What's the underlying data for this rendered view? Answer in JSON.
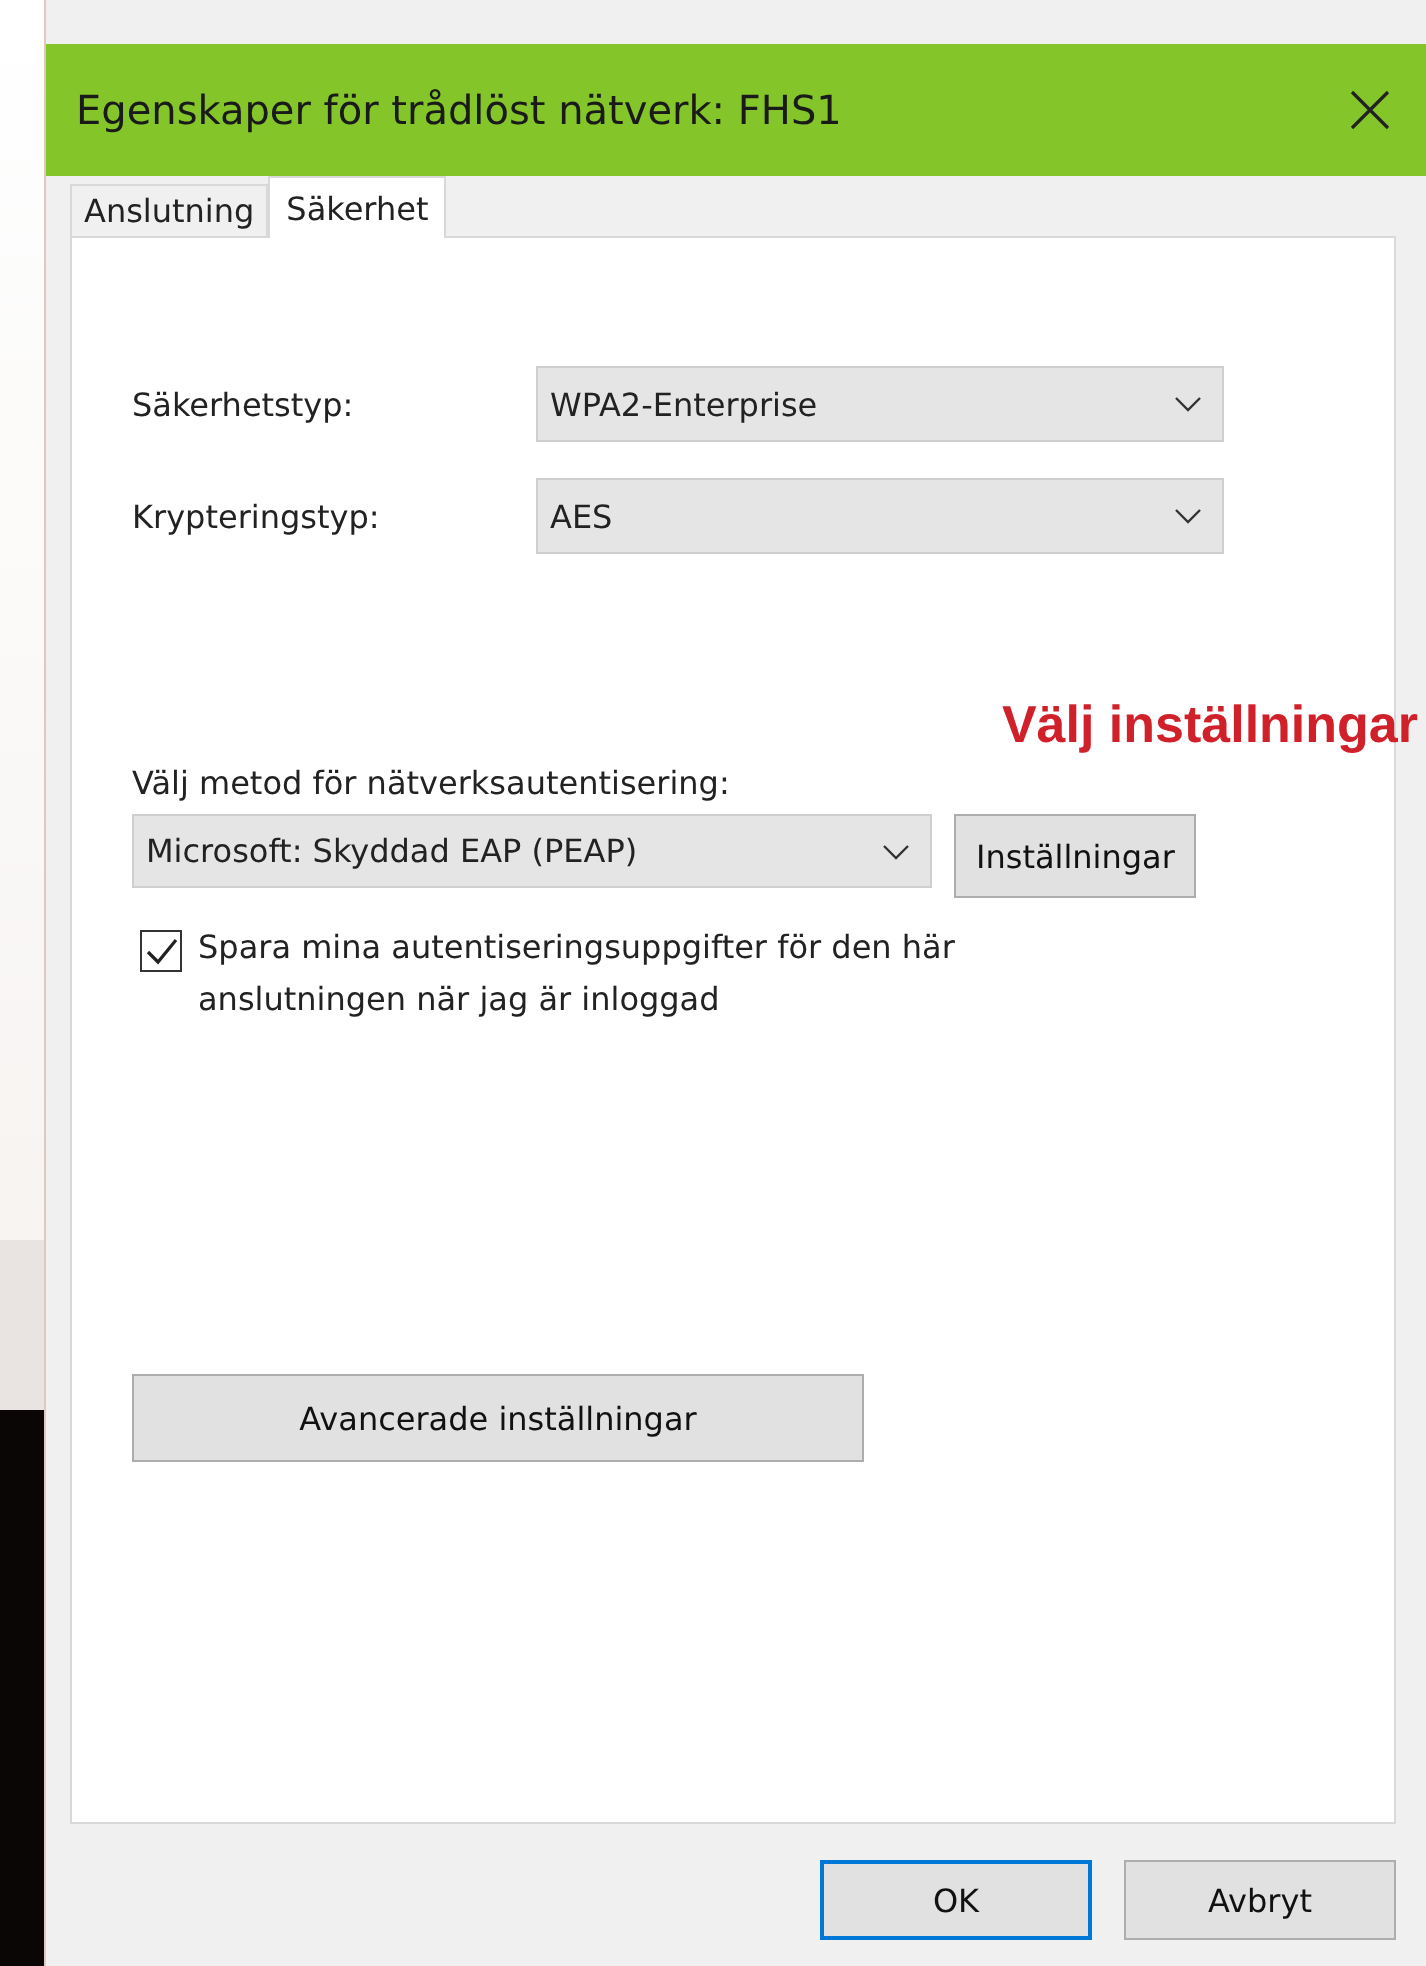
{
  "window": {
    "title": "Egenskaper för trådlöst nätverk: FHS1"
  },
  "tabs": [
    {
      "label": "Anslutning",
      "selected": false
    },
    {
      "label": "Säkerhet",
      "selected": true
    }
  ],
  "security_fields": [
    {
      "label": "Säkerhetstyp:",
      "value": "WPA2-Enterprise"
    },
    {
      "label": "Krypteringstyp:",
      "value": "AES"
    }
  ],
  "annotation": "Välj inställningar",
  "auth": {
    "label": "Välj metod för nätverksautentisering:",
    "value": "Microsoft: Skyddad EAP (PEAP)",
    "button": "Inställningar"
  },
  "remember": {
    "label": "Spara mina autentiseringsuppgifter för den här anslutningen när jag är inloggad",
    "checked": true
  },
  "advanced_button": "Avancerade inställningar",
  "buttons": [
    {
      "label": "OK",
      "default": true
    },
    {
      "label": "Avbryt",
      "default": false
    }
  ]
}
